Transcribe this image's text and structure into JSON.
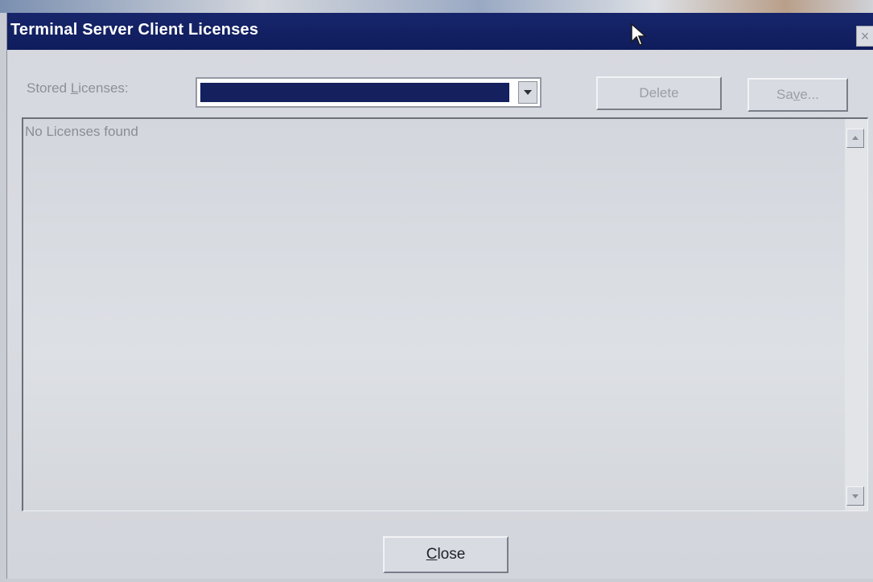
{
  "window": {
    "title": "Terminal Server Client Licenses",
    "close_glyph": "×"
  },
  "stored_licenses": {
    "label_prefix": "Stored ",
    "label_accel": "L",
    "label_suffix": "icenses:",
    "selected_value": ""
  },
  "buttons": {
    "delete_label": "Delete",
    "save_prefix": "Sa",
    "save_accel": "v",
    "save_suffix": "e...",
    "close_accel": "C",
    "close_suffix": "lose"
  },
  "list": {
    "empty_message": "No Licenses found"
  },
  "icons": {
    "cursor": "mouse-pointer-icon",
    "dropdown": "chevron-down-icon",
    "scroll_up": "scroll-up-arrow-icon",
    "scroll_down": "scroll-down-arrow-icon"
  },
  "colors": {
    "titlebar": "#17256b",
    "selection": "#15205f",
    "dialog_bg": "#d8dbe1"
  }
}
